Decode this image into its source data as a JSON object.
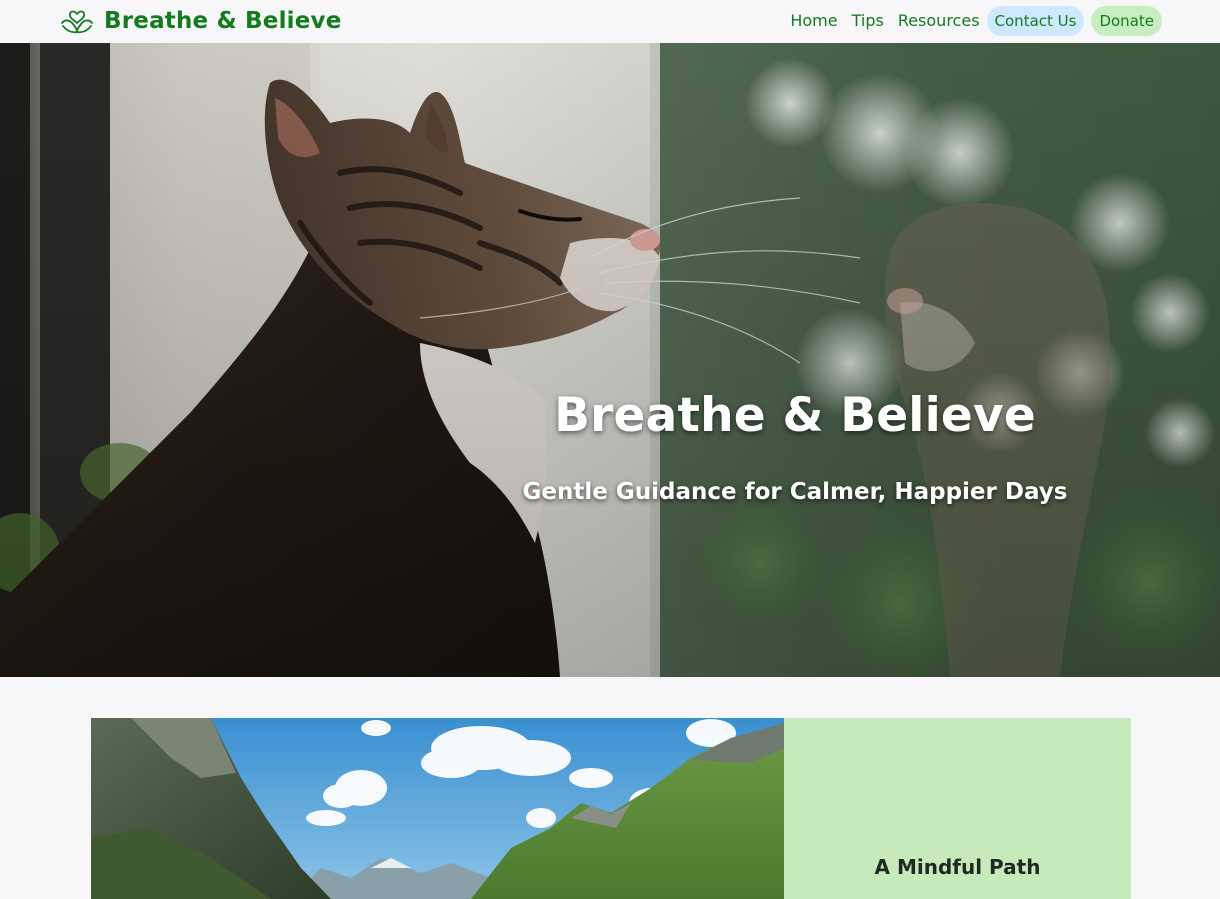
{
  "header": {
    "brand_name": "Breathe & Believe",
    "brand_icon": "hands-heart-icon",
    "nav": [
      {
        "label": "Home"
      },
      {
        "label": "Tips"
      },
      {
        "label": "Resources"
      }
    ],
    "contact_label": "Contact Us",
    "donate_label": "Donate"
  },
  "hero": {
    "title": "Breathe & Believe",
    "subtitle": "Gentle Guidance for Calmer, Happier Days"
  },
  "feature": {
    "title": "A Mindful Path"
  },
  "colors": {
    "brand_green": "#137a1e",
    "contact_pill": "#cde8ff",
    "donate_pill": "#c7eec1",
    "feature_panel": "#c7eabb",
    "page_background": "#f7f7fa"
  }
}
